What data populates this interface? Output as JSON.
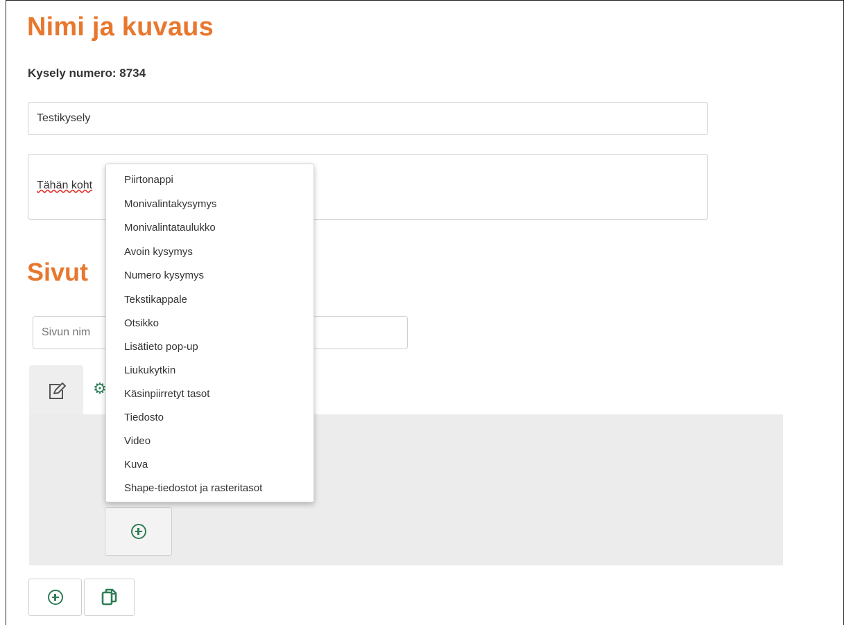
{
  "header": {
    "title": "Nimi ja kuvaus",
    "survey_number": "Kysely numero: 8734"
  },
  "form": {
    "title_value": "Testikysely",
    "description_value": "Tähän koht"
  },
  "pages": {
    "heading": "Sivut",
    "page_name_value": "Sivun nim"
  },
  "menu": {
    "items": [
      "Piirtonappi",
      "Monivalintakysymys",
      "Monivalintataulukko",
      "Avoin kysymys",
      "Numero kysymys",
      "Tekstikappale",
      "Otsikko",
      "Lisätieto pop-up",
      "Liukukytkin",
      "Käsinpiirretyt tasot",
      "Tiedosto",
      "Video",
      "Kuva",
      "Shape-tiedostot ja rasteritasot"
    ]
  },
  "icons": {
    "edit_tab": "edit-icon",
    "settings_tab": "settings-icon",
    "add_element": "add-circle-icon",
    "add_page": "add-circle-icon",
    "copy_page": "copy-icon"
  },
  "colors": {
    "heading": "#e8772e",
    "icon": "#2e7d55",
    "panel": "#ececec"
  }
}
